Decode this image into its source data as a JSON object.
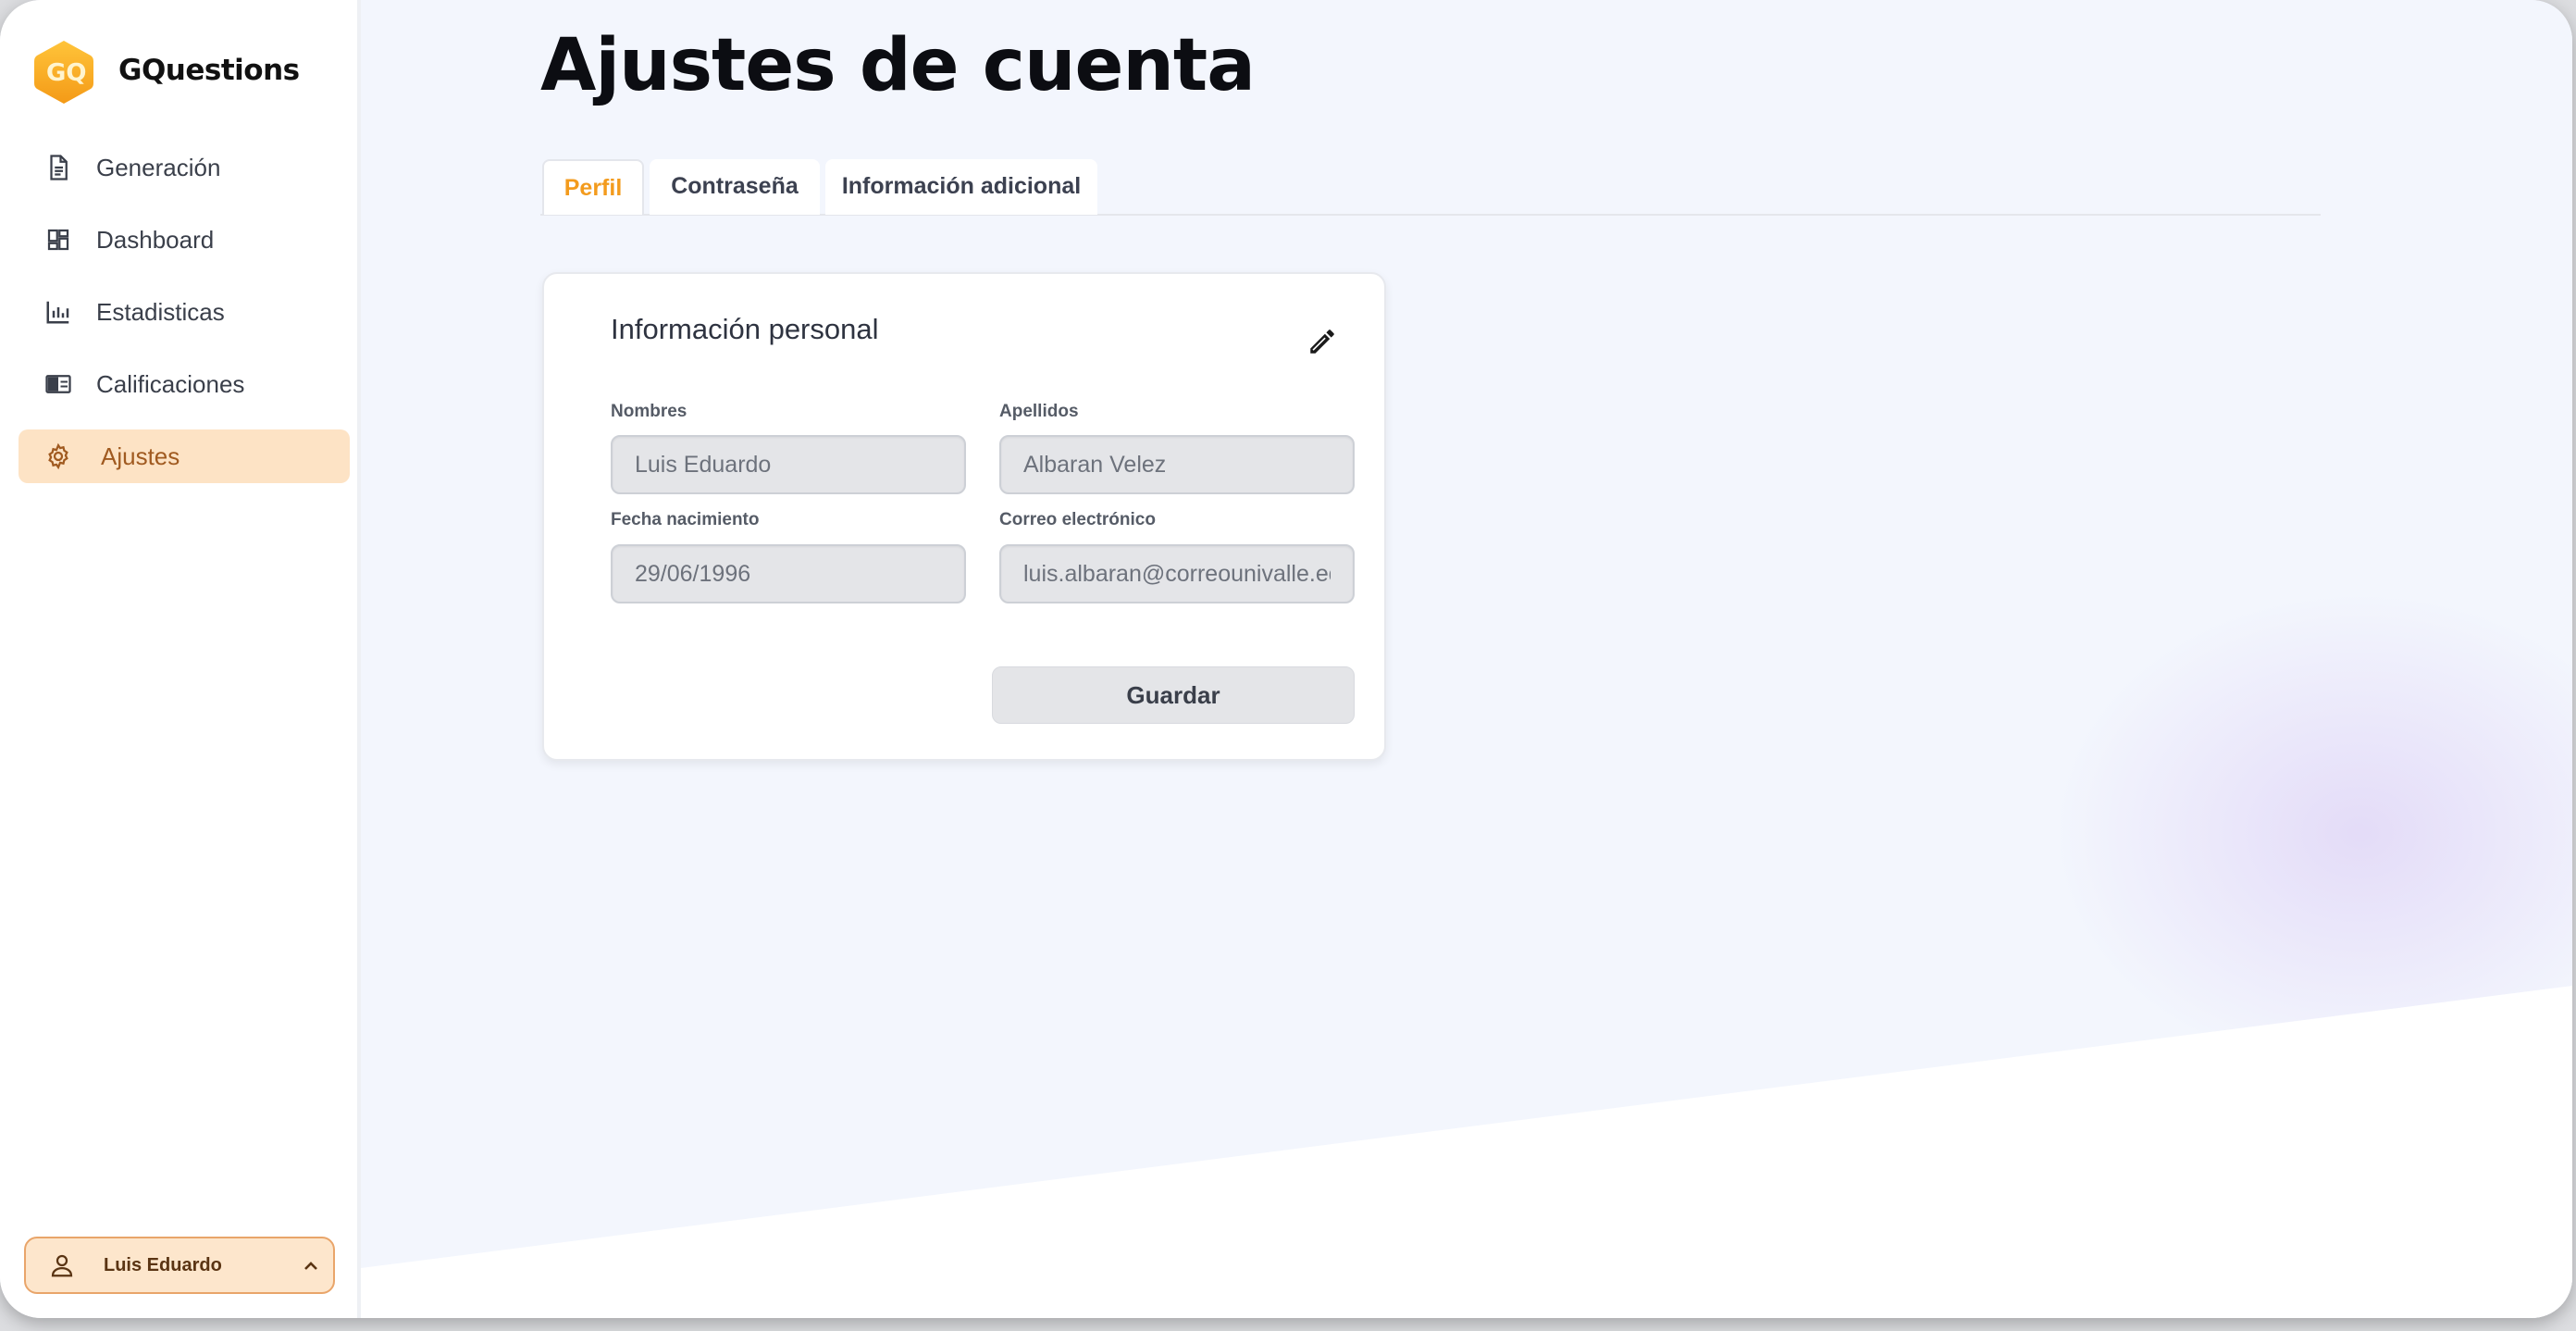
{
  "app": {
    "logo_text": "GQ",
    "brand": "GQuestions"
  },
  "sidebar": {
    "items": [
      {
        "label": "Generación",
        "icon": "document-icon"
      },
      {
        "label": "Dashboard",
        "icon": "dashboard-icon"
      },
      {
        "label": "Estadisticas",
        "icon": "bar-chart-icon"
      },
      {
        "label": "Calificaciones",
        "icon": "grades-icon"
      },
      {
        "label": "Ajustes",
        "icon": "gear-icon",
        "active": true
      }
    ],
    "user": {
      "name": "Luis Eduardo"
    }
  },
  "page": {
    "title": "Ajustes de cuenta"
  },
  "tabs": [
    {
      "label": "Perfil",
      "active": true
    },
    {
      "label": "Contraseña"
    },
    {
      "label": "Información adicional"
    }
  ],
  "card": {
    "title": "Información personal",
    "fields": {
      "nombres": {
        "label": "Nombres",
        "value": "Luis Eduardo"
      },
      "apellidos": {
        "label": "Apellidos",
        "value": "Albaran Velez"
      },
      "fecha": {
        "label": "Fecha nacimiento",
        "value": "29/06/1996"
      },
      "correo": {
        "label": "Correo electrónico",
        "value": "luis.albaran@correounivalle.edu.co"
      }
    },
    "save_label": "Guardar"
  },
  "colors": {
    "accent": "#f39b1d",
    "active_nav_bg": "#fde3c5",
    "page_bg": "#f3f6fd"
  }
}
